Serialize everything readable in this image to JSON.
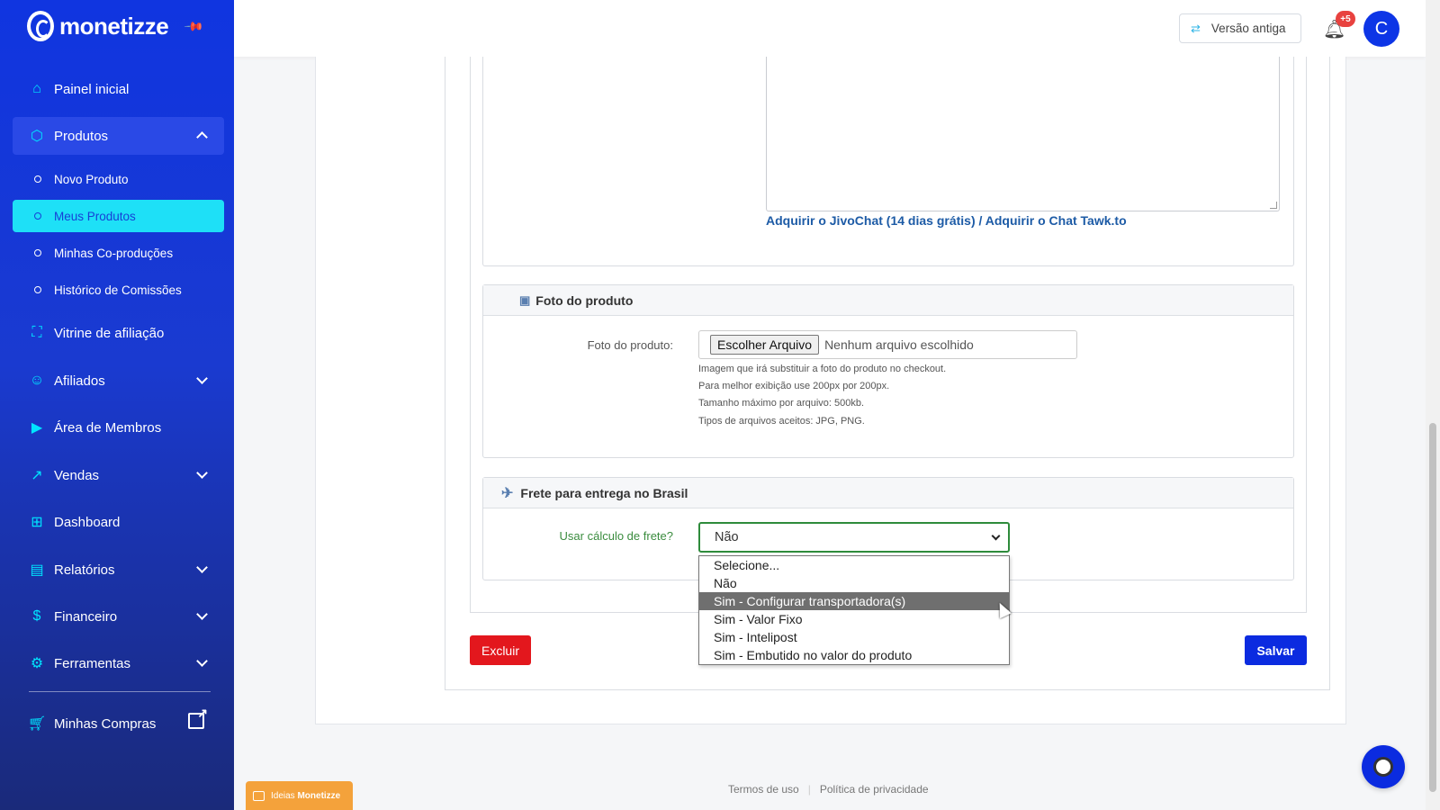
{
  "brand": {
    "name": "monetizze"
  },
  "sidebar": {
    "items": [
      {
        "label": "Painel inicial",
        "icon": "home-icon"
      },
      {
        "label": "Produtos",
        "icon": "box-icon",
        "expanded": true
      },
      {
        "label": "Vitrine de afiliação",
        "icon": "shopping-bag-icon"
      },
      {
        "label": "Afiliados",
        "icon": "users-icon"
      },
      {
        "label": "Área de Membros",
        "icon": "play-icon"
      },
      {
        "label": "Vendas",
        "icon": "trending-up-icon"
      },
      {
        "label": "Dashboard",
        "icon": "grid-icon"
      },
      {
        "label": "Relatórios",
        "icon": "document-icon"
      },
      {
        "label": "Financeiro",
        "icon": "dollar-icon"
      },
      {
        "label": "Ferramentas",
        "icon": "gear-icon"
      },
      {
        "label": "Minhas Compras",
        "icon": "cart-icon"
      }
    ],
    "subitems": [
      {
        "label": "Novo Produto"
      },
      {
        "label": "Meus Produtos",
        "active": true
      },
      {
        "label": "Minhas Co-produções"
      },
      {
        "label": "Histórico de Comissões"
      }
    ]
  },
  "header": {
    "old_version_label": "Versão antiga",
    "notification_badge": "+5",
    "avatar_initial": "C"
  },
  "chat": {
    "link_jivo": "Adquirir o JivoChat (14 dias grátis)",
    "separator": "/",
    "link_tawk": "Adquirir o Chat Tawk.to"
  },
  "photo_section": {
    "title": "Foto do produto",
    "label": "Foto do produto:",
    "file_button": "Escolher Arquivo",
    "file_status": "Nenhum arquivo escolhido",
    "help_lines": [
      "Imagem que irá substituir a foto do produto no checkout.",
      "Para melhor exibição use 200px por 200px.",
      "Tamanho máximo por arquivo: 500kb.",
      "Tipos de arquivos aceitos: JPG, PNG."
    ]
  },
  "shipping_section": {
    "title": "Frete para entrega no Brasil",
    "label": "Usar cálculo de frete?",
    "selected": "Não",
    "options": [
      "Selecione...",
      "Não",
      "Sim - Configurar transportadora(s)",
      "Sim - Valor Fixo",
      "Sim - Intelipost",
      "Sim - Embutido no valor do produto"
    ],
    "highlighted_option": "Sim - Configurar transportadora(s)"
  },
  "actions": {
    "delete_label": "Excluir",
    "save_label": "Salvar"
  },
  "footer": {
    "terms": "Termos de uso",
    "privacy": "Política de privacidade"
  },
  "ideas_tab": {
    "prefix": "Ideias",
    "brand": "Monetizze"
  },
  "colors": {
    "sidebar": "#1035e0",
    "accent": "#1ee0f7",
    "danger": "#e3171d",
    "primary": "#0b2be0",
    "success": "#2e8b3b"
  }
}
